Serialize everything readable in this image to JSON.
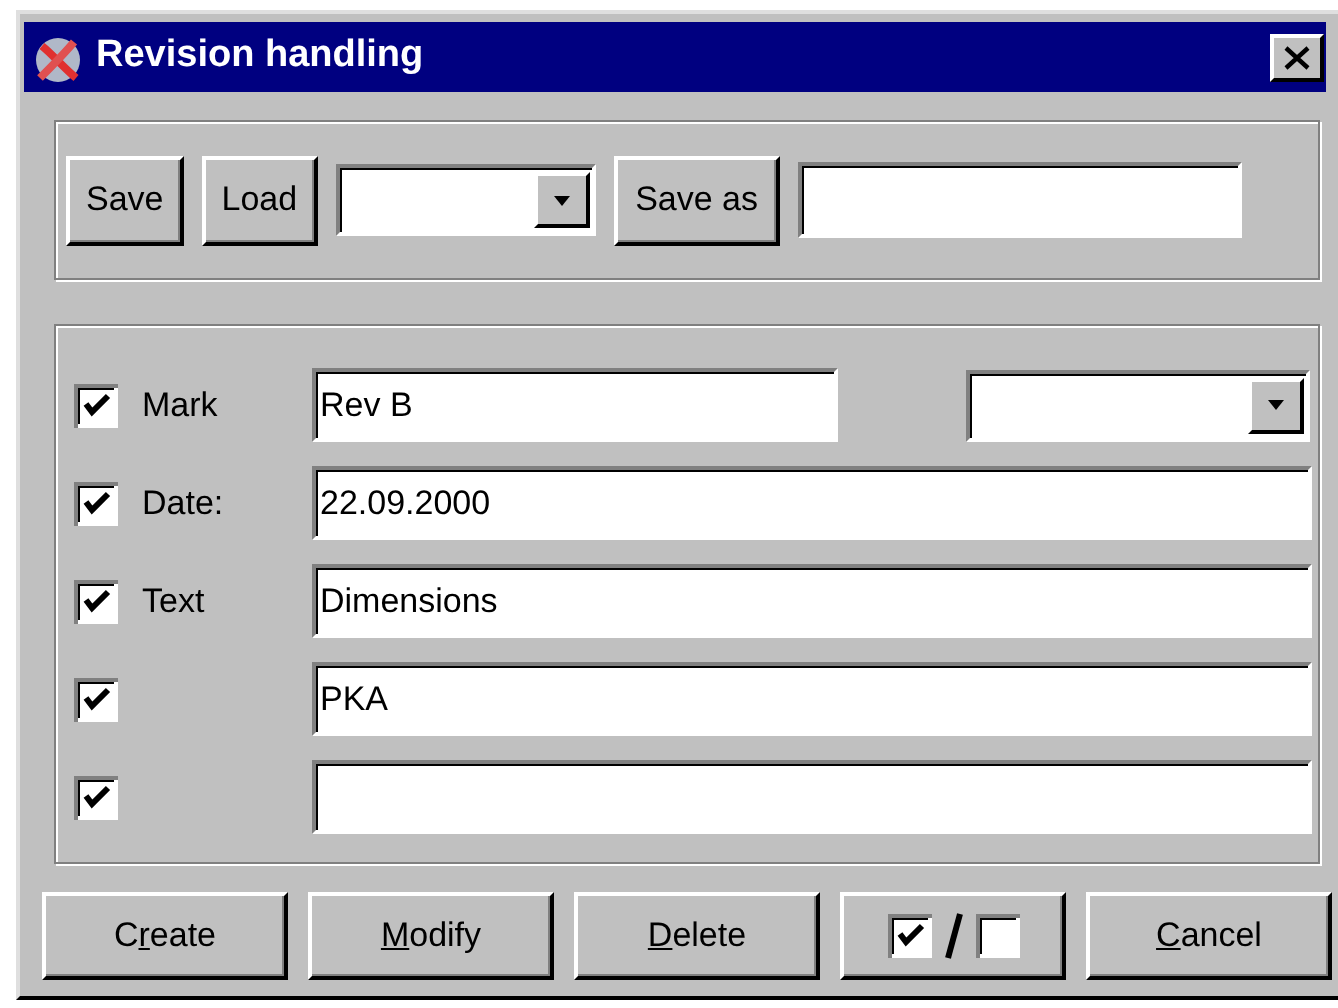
{
  "window": {
    "title": "Revision handling"
  },
  "file_bar": {
    "buttons": [
      {
        "label": "Save"
      },
      {
        "label": "Load"
      }
    ],
    "save_as_button": {
      "label": "Save as"
    }
  },
  "rows": [
    {
      "checked": true,
      "label": "Mark",
      "value": "Rev B",
      "kind": "short"
    },
    {
      "checked": true,
      "label": "Date:",
      "value": "22.09.2000",
      "kind": "wide"
    },
    {
      "checked": true,
      "label": "Text",
      "value": "Dimensions",
      "kind": "wide"
    },
    {
      "checked": true,
      "value": "PKA",
      "kind": "wide"
    },
    {
      "checked": true,
      "kind": "wide"
    }
  ],
  "buttons": [
    {
      "kind": "text",
      "before": "C",
      "mnemonic": "r",
      "after": "eate"
    },
    {
      "kind": "text",
      "mnemonic": "M",
      "after": "odify"
    },
    {
      "kind": "text",
      "mnemonic": "D",
      "after": "elete"
    },
    {
      "kind": "toggle"
    },
    {
      "kind": "text",
      "mnemonic": "C",
      "after": "ancel"
    }
  ]
}
